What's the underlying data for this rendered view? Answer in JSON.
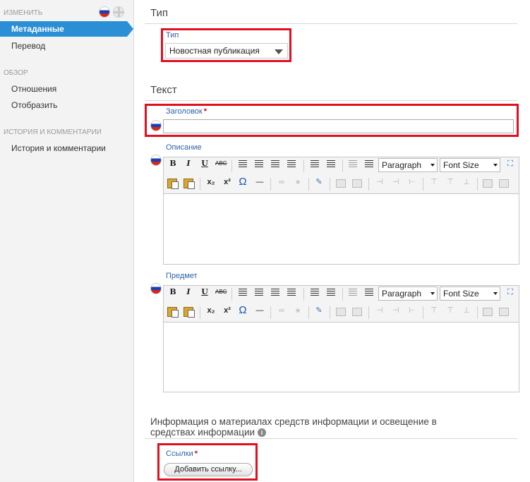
{
  "sidebar": {
    "section_edit": "ИЗМЕНИТЬ",
    "active_item": "Метаданные",
    "item_translation": "Перевод",
    "section_overview": "ОБЗОР",
    "item_relations": "Отношения",
    "item_display": "Отобразить",
    "section_history": "ИСТОРИЯ И КОММЕНТАРИИ",
    "item_history": "История и комментарии",
    "accent_color": "#2b8fd6"
  },
  "type_section": {
    "title": "Тип",
    "field_label": "Тип",
    "selected_value": "Новостная публикация"
  },
  "text_section": {
    "title": "Текст",
    "heading_label": "Заголовок",
    "heading_required": "*",
    "heading_value": "",
    "description_label": "Описание",
    "subject_label": "Предмет"
  },
  "editor": {
    "paragraph_format": "Paragraph",
    "font_size": "Font Size",
    "bold_glyph": "B",
    "italic_glyph": "I",
    "underline_glyph": "U",
    "strike_glyph": "ABC",
    "subscript_glyph": "x₂",
    "superscript_glyph": "x²",
    "special_char_glyph": "Ω",
    "hr_glyph": "—"
  },
  "info_section": {
    "title": "Информация о материалах средств информации и освещение в средствах информации",
    "info_icon": "i",
    "links_label": "Ссылки",
    "links_required": "*",
    "add_link_button": "Добавить ссылку..."
  },
  "colors": {
    "required_box": "#e01020",
    "label_blue": "#2d62a8"
  }
}
